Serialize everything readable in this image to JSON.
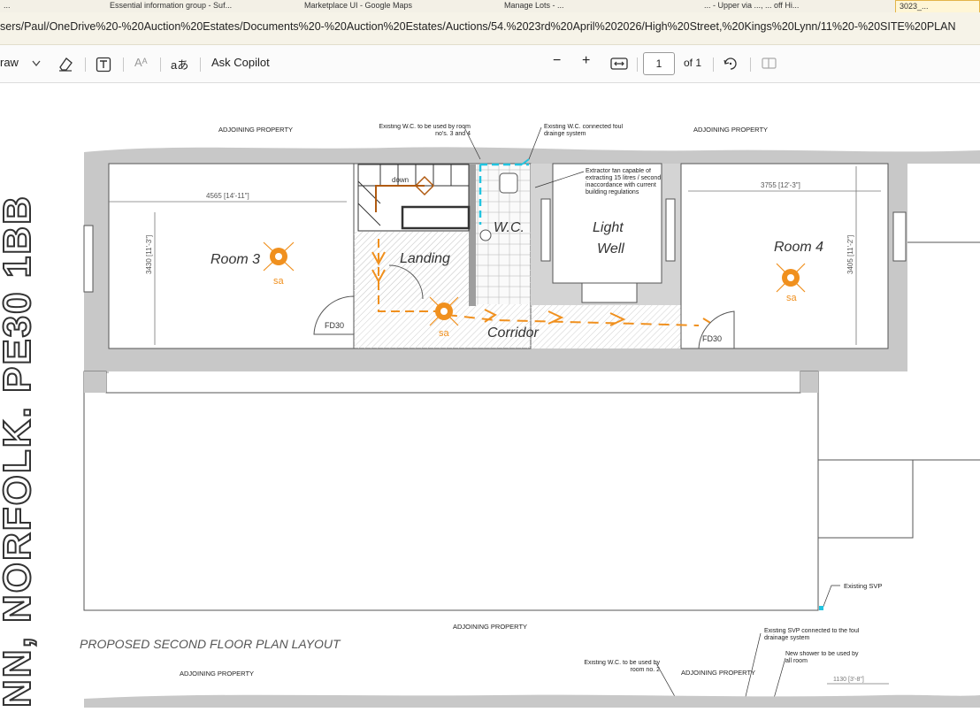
{
  "browser": {
    "tabs": [
      {
        "label": "..."
      },
      {
        "label": "Essential information group - Suf..."
      },
      {
        "label": "Marketplace UI - Google Maps"
      },
      {
        "label": "Manage Lots - ..."
      },
      {
        "label": "... - Upper via ..., ... off Hi..."
      },
      {
        "label": "3023_..."
      }
    ],
    "address": "sers/Paul/OneDrive%20-%20Auction%20Estates/Documents%20-%20Auction%20Estates/Auctions/54.%2023rd%20April%202026/High%20Street,%20Kings%20Lynn/11%20-%20SITE%20PLAN"
  },
  "toolbar": {
    "draw_label": "raw",
    "read_aloud_glyph": "Aᴬ",
    "translate_glyph": "aあ",
    "copilot_label": "Ask Copilot",
    "zoom_out_glyph": "−",
    "zoom_in_glyph": "+",
    "page_number": "1",
    "page_of": "of 1",
    "icons": [
      "chevron-down-icon",
      "eraser-icon",
      "text-box-icon",
      "read-aloud-icon",
      "translate-icon",
      "zoom-out-icon",
      "zoom-in-icon",
      "fit-width-icon",
      "rotate-icon",
      "page-view-icon"
    ]
  },
  "plan": {
    "vertical_title": "NN, NORFOLK. PE30 1BB",
    "adjoining_top_left": "ADJOINING PROPERTY",
    "adjoining_top_right": "ADJOINING PROPERTY",
    "adjoining_bottom_mid": "ADJOINING PROPERTY",
    "adjoining_bottom_left": "ADJOINING PROPERTY",
    "adjoining_bottom_right": "ADJOINING PROPERTY",
    "note_wc_rooms_34": "Existing W.C. to be used by room no's. 3 and 4",
    "note_wc_foul": "Existing W.C. connected foul drainge system",
    "note_extractor": "Extractor fan capable of extracting 15 litres / second inaccordance with current building regulations",
    "note_svp": "Existing SVP",
    "note_svp_connected": "Existing SVP connected to the foul drainage system",
    "note_shower": "New shower to be used by all room",
    "note_wc_room2": "Existing W.C. to be used by room no. 2",
    "dim_room3_width": "4565 [14'-11\"]",
    "dim_room3_height": "3430 [11'-3\"]",
    "dim_room4_width": "3755 [12'-3\"]",
    "dim_room4_height": "3405 [11'-2\"]",
    "dim_bottom": "1130 [3'-8\"]",
    "label_room3": "Room 3",
    "label_room4": "Room 4",
    "label_landing": "Landing",
    "label_wc": "W.C.",
    "label_light": "Light",
    "label_well": "Well",
    "label_corridor": "Corridor",
    "label_down": "down",
    "label_fd30_left": "FD30",
    "label_fd30_right": "FD30",
    "label_sa": "sa",
    "layout_title": "PROPOSED SECOND FLOOR PLAN LAYOUT",
    "colors": {
      "wall": "#c8c8c8",
      "wall_dark": "#8a8a8a",
      "orange": "#f0901e",
      "cyan": "#21c4e0",
      "stair": "#b05a10",
      "floor": "#ececec"
    }
  }
}
